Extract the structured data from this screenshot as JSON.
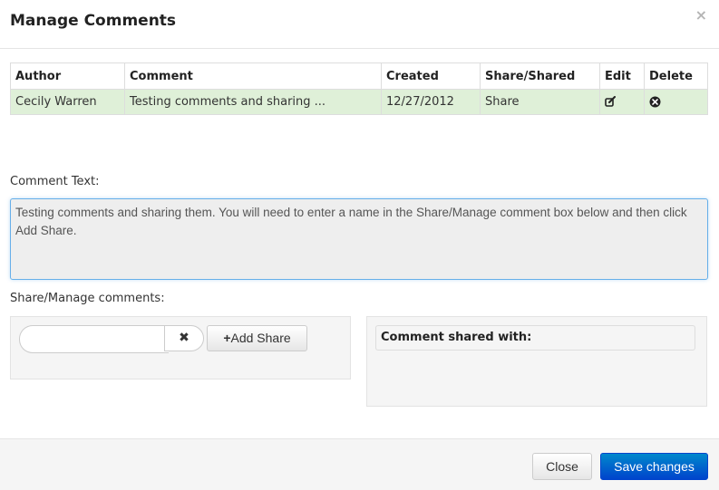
{
  "modal": {
    "title": "Manage Comments",
    "close_glyph": "×"
  },
  "table": {
    "columns": [
      "Author",
      "Comment",
      "Created",
      "Share/Shared",
      "Edit",
      "Delete"
    ],
    "rows": [
      {
        "author": "Cecily Warren",
        "comment": "Testing comments and sharing ...",
        "created": "12/27/2012",
        "share": "Share",
        "edit_icon": "edit-icon",
        "delete_icon": "remove-circle-icon"
      }
    ],
    "row_color": "#dff0d8"
  },
  "comment_text": {
    "label": "Comment Text:",
    "value": "Testing comments and sharing them. You will need to enter a name in the Share/Manage comment box below and then click Add Share."
  },
  "share": {
    "label": "Share/Manage comments:",
    "input_value": "",
    "input_placeholder": "",
    "clear_glyph": "✖",
    "add_share_label": "Add Share",
    "add_share_glyph": "+",
    "shared_with_label": "Comment shared with:"
  },
  "footer": {
    "close_label": "Close",
    "save_label": "Save changes",
    "accent_color": "#0044cc"
  }
}
